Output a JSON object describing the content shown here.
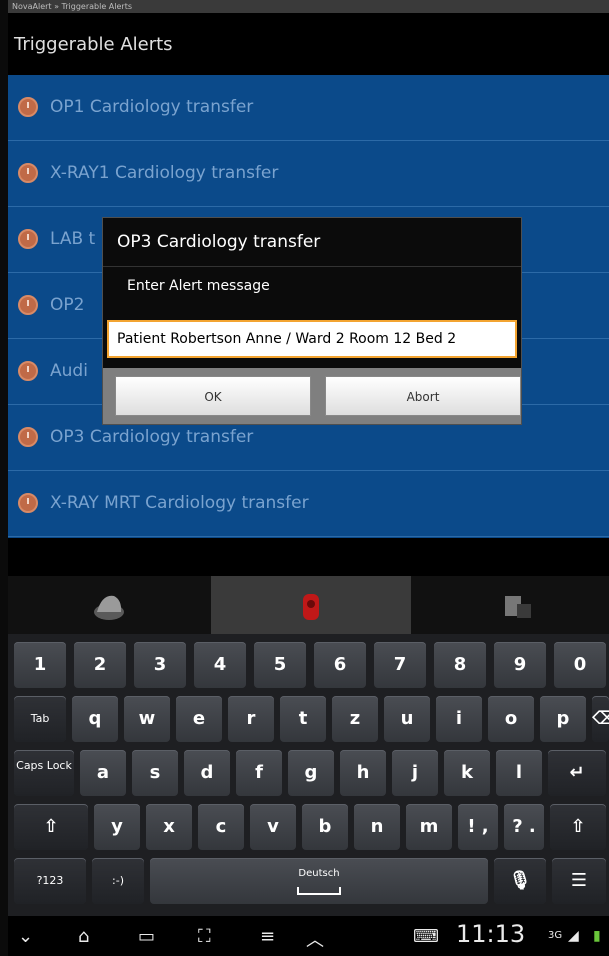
{
  "status": {
    "breadcrumb": "NovaAlert » Triggerable Alerts"
  },
  "header": {
    "title": "Triggerable Alerts"
  },
  "alerts": [
    "OP1 Cardiology transfer",
    "X-RAY1 Cardiology transfer",
    "LAB t",
    "OP2",
    "Audi",
    "OP3 Cardiology transfer",
    "X-RAY MRT Cardiology transfer"
  ],
  "dialog": {
    "title": "OP3 Cardiology transfer",
    "prompt": "Enter Alert message",
    "input_value": "Patient Robertson Anne / Ward  2 Room 12 Bed  2",
    "ok_label": "OK",
    "abort_label": "Abort"
  },
  "keyboard": {
    "row1": [
      "1",
      "2",
      "3",
      "4",
      "5",
      "6",
      "7",
      "8",
      "9",
      "0"
    ],
    "row2": [
      "Tab",
      "q",
      "w",
      "e",
      "r",
      "t",
      "z",
      "u",
      "i",
      "o",
      "p"
    ],
    "row3": [
      "Caps Lock",
      "a",
      "s",
      "d",
      "f",
      "g",
      "h",
      "j",
      "k",
      "l"
    ],
    "row4": [
      "y",
      "x",
      "c",
      "v",
      "b",
      "n",
      "m",
      "! ,",
      "? ."
    ],
    "row5": {
      "symbols": "?123",
      "emoticon": ":-)",
      "space": "Deutsch"
    }
  },
  "navbar": {
    "time": "11:13",
    "network": "3G"
  },
  "icons": {
    "alert": "alarm-clock-icon",
    "backspace": "backspace-icon",
    "enter": "enter-icon",
    "shift": "shift-icon",
    "mic": "microphone-icon",
    "settings": "keyboard-settings-icon",
    "tab1": "helmet-icon",
    "tab2": "alarm-device-icon",
    "tab3": "devices-icon"
  },
  "colors": {
    "list_bg": "#0b4a8a",
    "input_focus": "#f3a431",
    "alert_icon": "#c06a47"
  }
}
